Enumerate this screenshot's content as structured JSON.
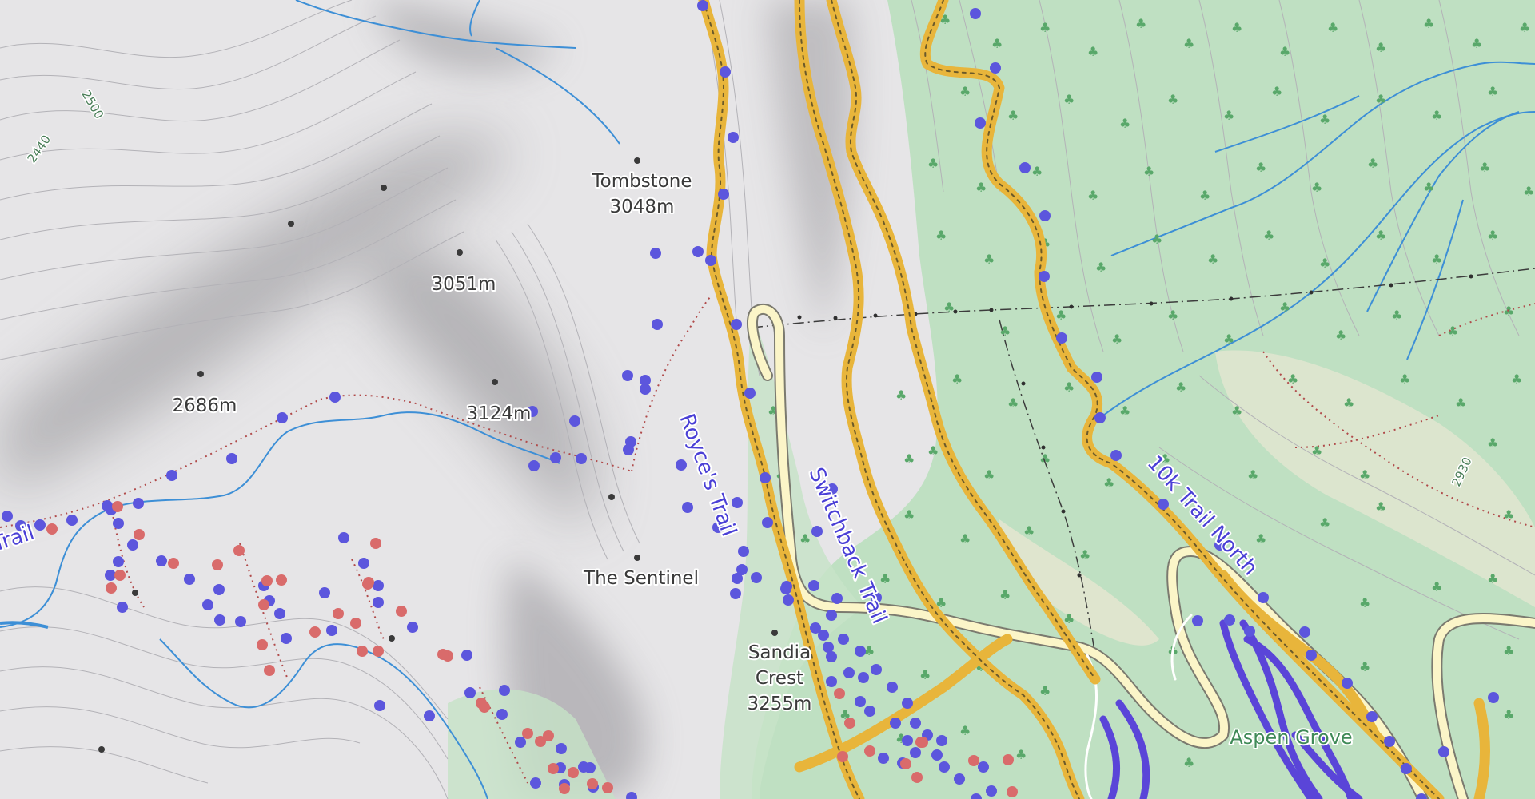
{
  "map": {
    "colors": {
      "background": "#e6e5e7",
      "forest": "#b9dcbd",
      "hillshade": "#9a999c",
      "contour": "#b2b1b6",
      "stream": "#3d8fd6",
      "road_fill": "#fbf5c8",
      "road_casing": "#7b7a6f",
      "trail_highlight": "#e8b53b",
      "trail_dash": "#6b5a2a",
      "waypoint_blue": "#5c56dd",
      "waypoint_red": "#d96b6b",
      "path_dotted": "#b04a4a",
      "power_line": "#404040",
      "route_purple": "#5a45d8"
    },
    "peaks": [
      {
        "name": "Tombstone",
        "elevation": "3048m"
      },
      {
        "name": "",
        "elevation": "3051m"
      },
      {
        "name": "",
        "elevation": "2686m"
      },
      {
        "name": "",
        "elevation": "3124m"
      },
      {
        "name": "The Sentinel",
        "elevation": ""
      },
      {
        "name": "Sandia\nCrest",
        "elevation": "3255m"
      }
    ],
    "labels": {
      "tombstone_name": "Tombstone",
      "tombstone_elev": "3048m",
      "peak_3051": "3051m",
      "peak_2686": "2686m",
      "peak_3124": "3124m",
      "sentinel": "The Sentinel",
      "sandia_line1": "Sandia",
      "sandia_line2": "Crest",
      "sandia_elev": "3255m"
    },
    "trails": {
      "royces": "Royce's Trail",
      "switchback": "Switchback Trail",
      "tenk_north": "10k Trail North",
      "left_trail_fragment": "Trail"
    },
    "contour_labels": {
      "c2500": "2500",
      "c2440": "2440",
      "c2930": "2930"
    },
    "places": {
      "aspen_grove": "Aspen Grove"
    },
    "icons": [
      "tree-icon",
      "waypoint-marker-icon",
      "peak-marker-icon"
    ]
  }
}
